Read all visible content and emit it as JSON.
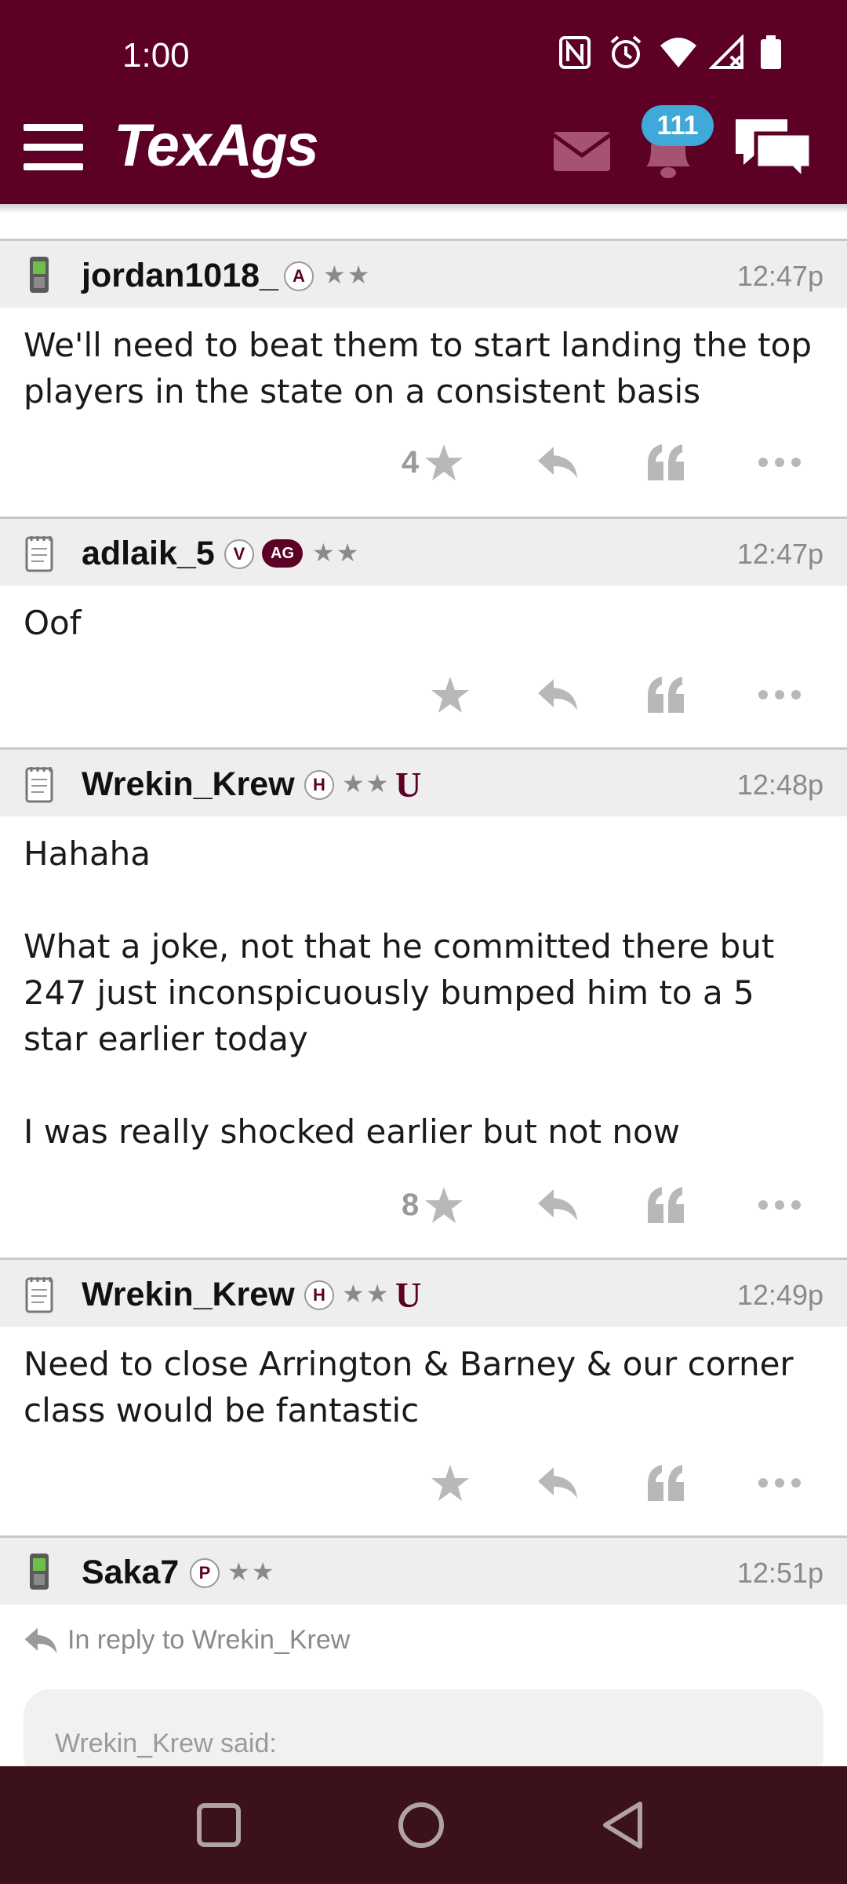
{
  "status_bar": {
    "time": "1:00"
  },
  "app": {
    "logo": "TexAgs",
    "notification_count": "111"
  },
  "posts": [
    {
      "username": "jordan1018_",
      "level": "A",
      "stars": "★★",
      "timestamp": "12:47p",
      "body": "We'll need to beat them to start landing the top players in the state on a consistent basis",
      "likes": "4"
    },
    {
      "username": "adlaik_5",
      "level": "V",
      "badge": "AG",
      "stars": "★★",
      "timestamp": "12:47p",
      "body": "Oof",
      "likes": ""
    },
    {
      "username": "Wrekin_Krew",
      "level": "H",
      "stars": "★★",
      "school": "U",
      "timestamp": "12:48p",
      "body": "Hahaha\n\nWhat a joke, not that he committed there but 247 just inconspicuously bumped him to a 5 star earlier today\n\nI was really shocked earlier but not now",
      "likes": "8"
    },
    {
      "username": "Wrekin_Krew",
      "level": "H",
      "stars": "★★",
      "school": "U",
      "timestamp": "12:49p",
      "body": "Need to close Arrington & Barney & our corner class would be fantastic",
      "likes": ""
    },
    {
      "username": "Saka7",
      "level": "P",
      "stars": "★★",
      "timestamp": "12:51p",
      "reply_to": "In reply to Wrekin_Krew",
      "quote_author": "Wrekin_Krew said:"
    }
  ],
  "colors": {
    "brand": "#5c0025",
    "badge": "#3fa9d9",
    "navbar": "#3b111b"
  }
}
